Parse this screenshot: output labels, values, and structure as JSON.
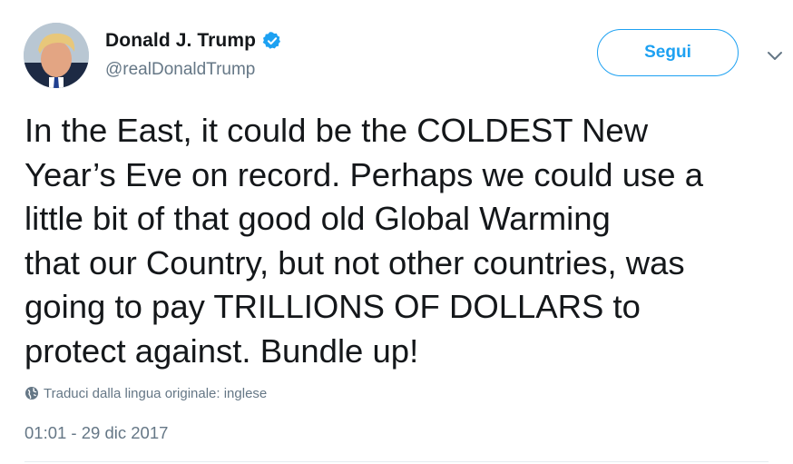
{
  "author": {
    "display_name": "Donald J. Trump",
    "handle": "@realDonaldTrump",
    "verified_icon": "verified-badge-icon",
    "avatar_icon": "profile-photo"
  },
  "actions": {
    "follow_label": "Segui",
    "menu_icon": "chevron-down-icon"
  },
  "tweet": {
    "text": "In the East, it could be the COLDEST New\nYear’s Eve on record. Perhaps we could use a\nlittle bit of that good old Global Warming\nthat our Country, but not other countries, was\ngoing to pay TRILLIONS OF DOLLARS to\nprotect against. Bundle up!",
    "translate_label": "Traduci dalla lingua originale: inglese",
    "translate_icon": "globe-icon",
    "timestamp": "01:01 - 29 dic 2017"
  },
  "colors": {
    "accent": "#1da1f2",
    "text": "#14171a",
    "secondary_text": "#657786",
    "divider": "#e6ecf0"
  }
}
